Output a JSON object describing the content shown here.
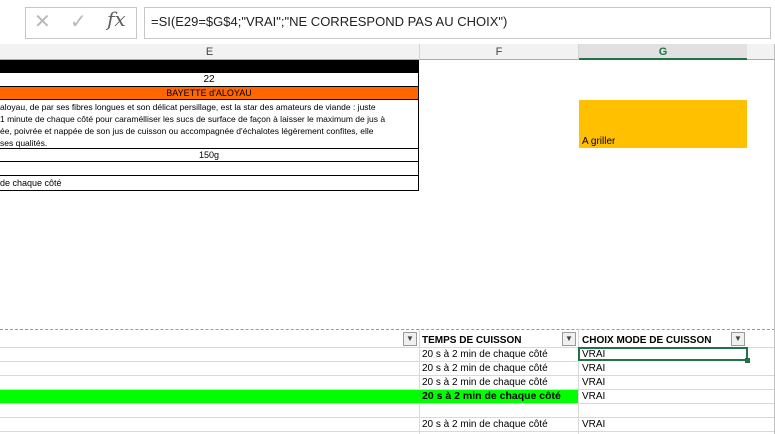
{
  "formula_bar": {
    "cancel_icon": "close-icon",
    "enter_icon": "check-icon",
    "fx_label": "fx",
    "formula": "=SI(E29=$G$4;\"VRAI\";\"NE CORRESPOND PAS AU CHOIX\")"
  },
  "columns": {
    "e": "E",
    "f": "F",
    "g": "G"
  },
  "top_section": {
    "number": "22",
    "product_title": "BAYETTE d'ALOYAU",
    "description_lines": [
      "aloyau, de par ses fibres longues et son délicat persillage, est la star des amateurs de viande :  juste",
      " 1 minute de chaque côté pour caramélliser les sucs de surface de façon à laisser le maximum de jus à",
      "ée, poivrée et nappée de son jus de cuisson ou accompagnée d'échalotes légèrement confites, elle",
      " ses qualités."
    ],
    "weight": "150g",
    "cooking_note": "de chaque côté",
    "mode_choice": "A griller"
  },
  "colors": {
    "orange_title": "#ff6600",
    "yellow_choice": "#ffc000",
    "green_highlight": "#00ff00",
    "selected_border": "#217346"
  },
  "table": {
    "headers": {
      "temps": "TEMPS DE CUISSON",
      "choix": "CHOIX MODE DE CUISSON"
    },
    "rows": [
      {
        "temps": "20 s à 2 min de chaque côté",
        "choix": "VRAI"
      },
      {
        "temps": "20 s à 2 min de chaque côté",
        "choix": "VRAI"
      },
      {
        "temps": "20 s à 2 min de chaque côté",
        "choix": "VRAI"
      },
      {
        "temps": "20 s à 2 min de chaque côté",
        "choix": "VRAI"
      },
      {
        "temps": "",
        "choix": ""
      },
      {
        "temps": "20 s à 2 min de chaque côté",
        "choix": "VRAI"
      }
    ]
  }
}
